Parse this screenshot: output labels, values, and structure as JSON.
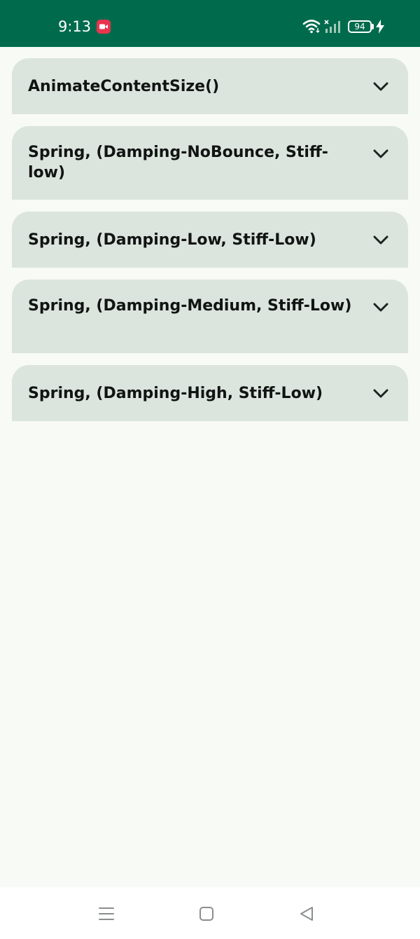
{
  "status_bar": {
    "time": "9:13",
    "battery_level": "94",
    "background_color": "#006b4c",
    "icons": [
      "screen-record-icon",
      "wifi-icon",
      "signal-icon",
      "battery-icon",
      "charging-icon"
    ]
  },
  "cards": [
    {
      "title": "AnimateContentSize()",
      "icon": "chevron-down-icon"
    },
    {
      "title": "Spring, (Damping-NoBounce, Stiff-low)",
      "icon": "chevron-down-icon"
    },
    {
      "title": "Spring, (Damping-Low, Stiff-Low)",
      "icon": "chevron-down-icon"
    },
    {
      "title": "Spring, (Damping-Medium, Stiff-Low)",
      "icon": "chevron-down-icon"
    },
    {
      "title": "Spring, (Damping-High, Stiff-Low)",
      "icon": "chevron-down-icon"
    }
  ],
  "colors": {
    "card_background": "#dbe5dd",
    "page_background": "#f8faf5",
    "title_text": "#111412",
    "record_badge": "#e8344e"
  },
  "nav_bar": {
    "icons": [
      "menu-icon",
      "home-icon",
      "back-icon"
    ]
  }
}
